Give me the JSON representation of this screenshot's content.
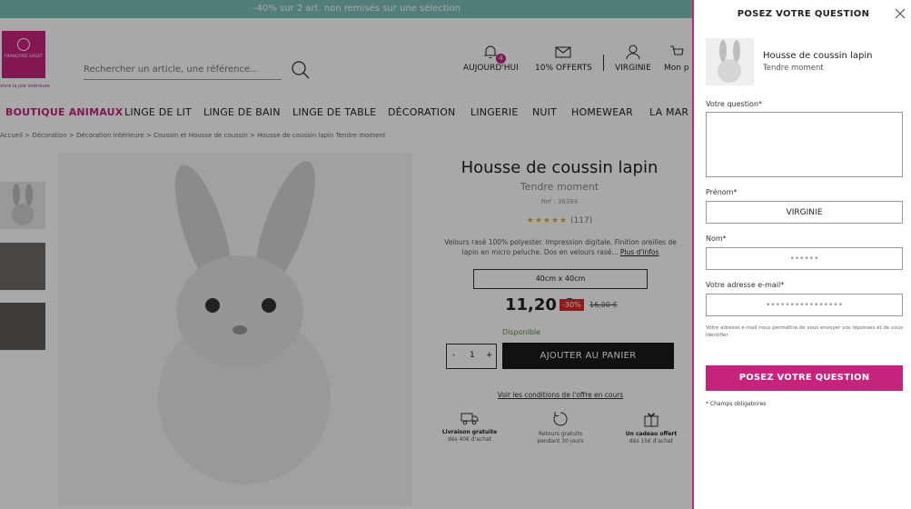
{
  "banner": {
    "text": "-40% sur 2 art. non remisés sur une sélection"
  },
  "logo": {
    "brand": "FRANÇOISE SAGET",
    "tagline": "vivre la joie intérieure"
  },
  "search": {
    "placeholder": "Rechercher un article, une référence..."
  },
  "header": {
    "today_label": "AUJOURD'HUI",
    "today_badge": "4",
    "offers_label": "10% OFFERTS",
    "account_label": "VIRGINIE",
    "cart_label": "Mon p"
  },
  "nav": {
    "items": [
      "BOUTIQUE ANIMAUX",
      "LINGE DE LIT",
      "LINGE DE BAIN",
      "LINGE DE TABLE",
      "DÉCORATION",
      "LINGERIE",
      "NUIT",
      "HOMEWEAR",
      "LA MAR"
    ]
  },
  "breadcrumb": {
    "text": "Accueil > Décoration > Décoration intérieure > Coussin et Housse de coussin > Housse de coussin lapin Tendre moment"
  },
  "product": {
    "title": "Housse de coussin lapin",
    "subtitle": "Tendre moment",
    "ref": "Ref : 36384",
    "stars": "★★★★★",
    "reviews": "(117)",
    "desc": "Velours rasé 100% polyester. Impression digitale. Finition oreilles de lapin en micro peluche. Dos en velours rasé...",
    "more_link": "Plus d'infos",
    "size": "40cm x 40cm",
    "price": "11,20 €",
    "discount": "-30%",
    "old_price": "16,00 €",
    "availability": "Disponible",
    "qty_minus": "-",
    "qty": "1",
    "qty_plus": "+",
    "add_to_cart": "AJOUTER AU PANIER",
    "conditions_link": "Voir les conditions de l'offre en cours",
    "features": [
      {
        "title": "Livraison gratuite",
        "text": "dès 40€ d'achat"
      },
      {
        "title": "Retours gratuits",
        "text": "pendant 30 jours"
      },
      {
        "title": "Un cadeau offert",
        "text": "dès 15€ d'achat"
      }
    ]
  },
  "modal": {
    "title": "POSEZ VOTRE QUESTION",
    "product_name": "Housse de coussin lapin",
    "product_sub": "Tendre moment",
    "question_label": "Votre question*",
    "question_value": "",
    "firstname_label": "Prénom*",
    "firstname_value": "VIRGINIE",
    "lastname_label": "Nom*",
    "lastname_value": "••••••",
    "email_label": "Votre adresse e-mail*",
    "email_value": "••••••••••••••••",
    "email_note": "Votre adresse e-mail nous permettra de vous envoyer vos réponses et de vous identifier.",
    "submit_label": "POSEZ VOTRE QUESTION",
    "required_note": "* Champs obligatoires"
  },
  "colors": {
    "brand": "#c6247c",
    "banner": "#7dbfb6",
    "cart_button": "#1b1b1b",
    "discount": "#d92a2a"
  }
}
